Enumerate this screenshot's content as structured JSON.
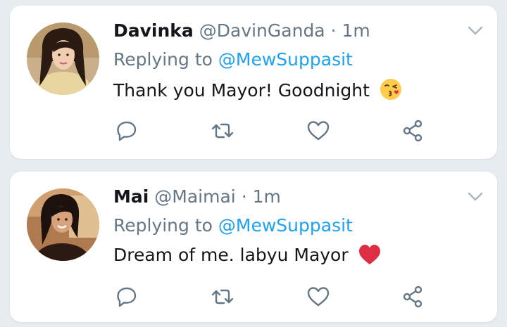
{
  "tweets": [
    {
      "display_name": "Davinka",
      "handle": "@DavinGanda",
      "time": "· 1m",
      "replying_prefix": "Replying to",
      "replying_to": "@MewSuppasit",
      "text": "Thank you Mayor! Goodnight",
      "emoji": "kissing-face-icon"
    },
    {
      "display_name": "Mai",
      "handle": "@Maimai",
      "time": "· 1m",
      "replying_prefix": "Replying to",
      "replying_to": "@MewSuppasit",
      "text": "Dream of me. labyu Mayor",
      "emoji": "red-heart-icon"
    }
  ],
  "colors": {
    "background": "#e6ecf0",
    "card": "#ffffff",
    "primary_text": "#14171a",
    "secondary_text": "#657786",
    "link": "#1da1f2",
    "heart": "#e0245e"
  }
}
